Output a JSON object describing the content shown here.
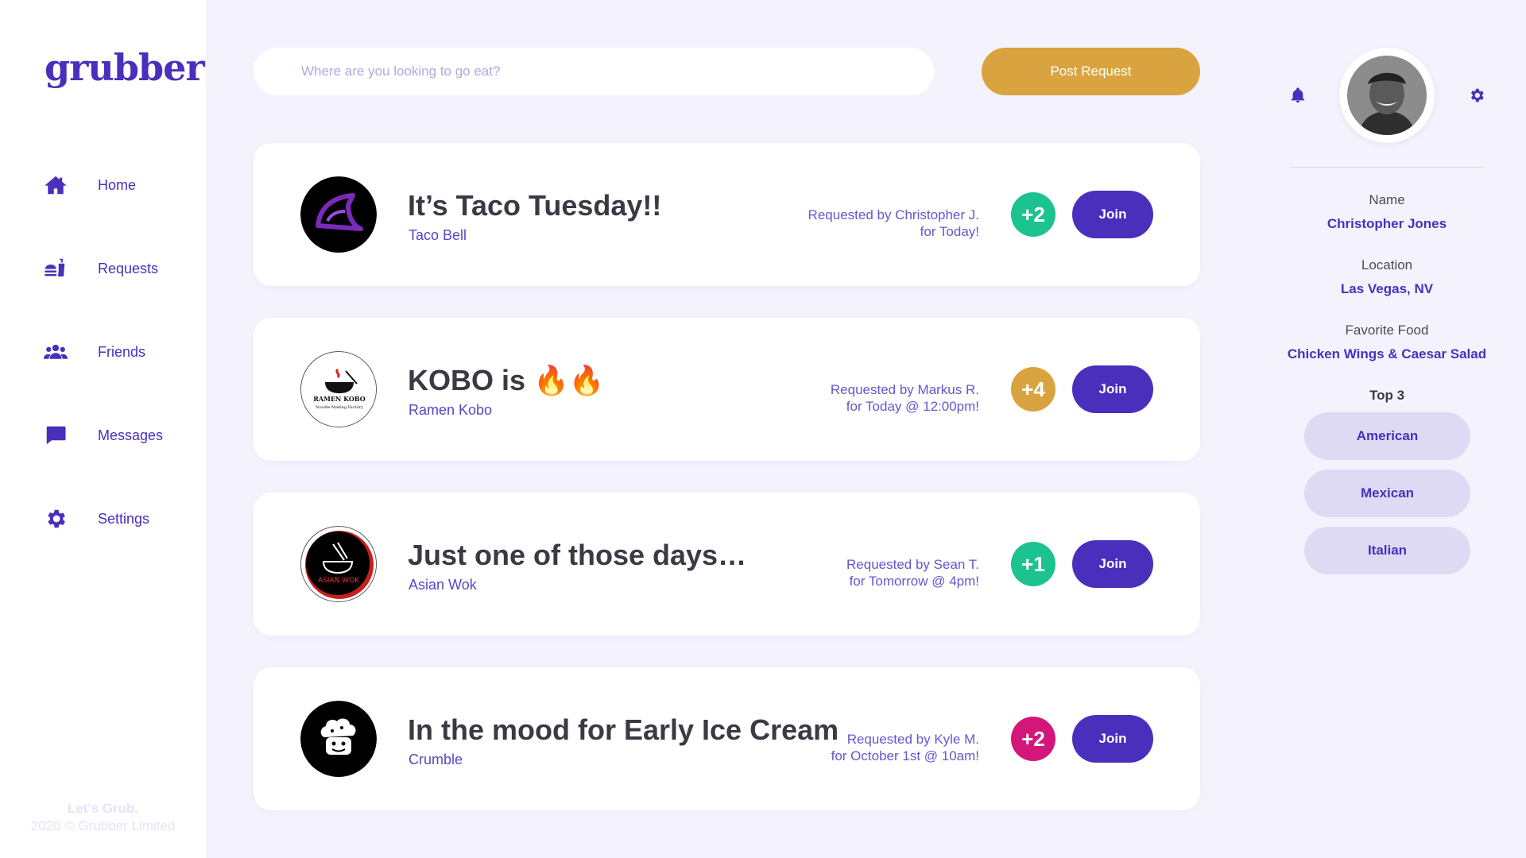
{
  "app": {
    "logo": "grubber"
  },
  "sidebar": {
    "items": [
      {
        "label": "Home",
        "icon": "home-icon"
      },
      {
        "label": "Requests",
        "icon": "food-tray-icon"
      },
      {
        "label": "Friends",
        "icon": "friends-icon"
      },
      {
        "label": "Messages",
        "icon": "message-icon"
      },
      {
        "label": "Settings",
        "icon": "gear-icon"
      }
    ],
    "footer_tagline": "Let's Grub.",
    "footer_copyright": "2020 © Grubber Limited"
  },
  "topbar": {
    "search_placeholder": "Where are you looking to go eat?",
    "post_button": "Post Request"
  },
  "requests": [
    {
      "title": "It’s Taco Tuesday!!",
      "restaurant": "Taco Bell",
      "requested_by": "Requested by Christopher J.",
      "when": "for Today!",
      "count": "+2",
      "count_color": "#1cc28f",
      "join": "Join"
    },
    {
      "title": "KOBO is 🔥🔥",
      "restaurant": "Ramen Kobo",
      "requested_by": "Requested by Markus R.",
      "when": "for Today @ 12:00pm!",
      "count": "+4",
      "count_color": "#d9a43f",
      "join": "Join",
      "logo_text": "RAMEN KOBO",
      "logo_subtext": "Noodle Making Factory"
    },
    {
      "title": "Just one of those days…",
      "restaurant": "Asian Wok",
      "requested_by": "Requested by Sean T.",
      "when": "for Tomorrow @ 4pm!",
      "count": "+1",
      "count_color": "#1cc28f",
      "join": "Join",
      "logo_text": "ASIAN WOK"
    },
    {
      "title": "In the mood for Early Ice Cream",
      "restaurant": "Crumble",
      "requested_by": "Requested by Kyle M.",
      "when": "for October 1st @ 10am!",
      "count": "+2",
      "count_color": "#d4157a",
      "join": "Join"
    }
  ],
  "profile": {
    "name_label": "Name",
    "name": "Christopher Jones",
    "location_label": "Location",
    "location": "Las Vegas, NV",
    "food_label": "Favorite Food",
    "food": "Chicken Wings & Caesar Salad",
    "top3_label": "Top 3",
    "top3": [
      "American",
      "Mexican",
      "Italian"
    ]
  },
  "colors": {
    "brand": "#4a2fbd",
    "accent": "#d9a43f",
    "background": "#f4f3fd"
  }
}
